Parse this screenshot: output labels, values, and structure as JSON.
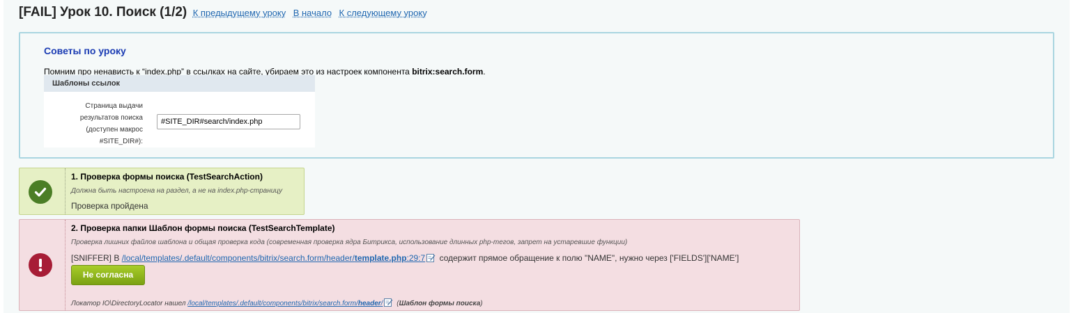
{
  "header": {
    "title": "[FAIL] Урок 10. Поиск (1/2)",
    "links": [
      "К предыдущему уроку",
      "В начало",
      "К следующему уроку"
    ]
  },
  "tips": {
    "title": "Советы по уроку",
    "text_prefix": "Помним про ненависть к “index.php” в ссылках на сайте, убираем это из настроек компонента ",
    "text_component": "bitrix:search.form",
    "text_suffix": ".",
    "panel": {
      "heading": "Шаблоны ссылок",
      "label_lines": [
        "Страница выдачи",
        "результатов поиска",
        "(доступен макрос",
        "#SITE_DIR#):"
      ],
      "input_value": "#SITE_DIR#search/index.php"
    }
  },
  "checks": [
    {
      "title": "1. Проверка формы поиска (TestSearchAction)",
      "description": "Должна быть настроена на раздел, а не на index.php-страницу",
      "result": "Проверка пройдена",
      "status": "ok",
      "icon": "check-icon"
    },
    {
      "title": "2. Проверка папки Шаблон формы поиска (TestSearchTemplate)",
      "description": "Проверка лишних файлов шаблона и общая проверка кода (современная проверка ядра Битрикса, использование длинных php-тегов, запрет на устаревшие функции)",
      "status": "fail",
      "icon": "exclamation-icon",
      "sniffer": {
        "prefix": "[SNIFFER] В ",
        "path_dir": "/local/templates/.default/components/bitrix/search.form/header/",
        "path_file": "template.php",
        "path_line": ":29:7",
        "suffix": " содержит прямое обращение к полю \"NAME\", нужно через ['FIELDS']['NAME']"
      },
      "button_label": "Не согласна",
      "locator": {
        "prefix": "Локатор IO\\DirectoryLocator нашел ",
        "path_dir": "/local/templates/.default/components/bitrix/search.form/",
        "path_last": "header",
        "path_end": "/",
        "suffix_open": " (",
        "template_name": "Шаблон формы поиска",
        "suffix_close": ")"
      }
    }
  ],
  "colors": {
    "ok_bg": "#e6f0c5",
    "ok_icon": "#4b7e26",
    "fail_bg": "#f4dee2",
    "fail_icon": "#a71d36",
    "link": "#2067b0",
    "button": "#8ab71c"
  }
}
